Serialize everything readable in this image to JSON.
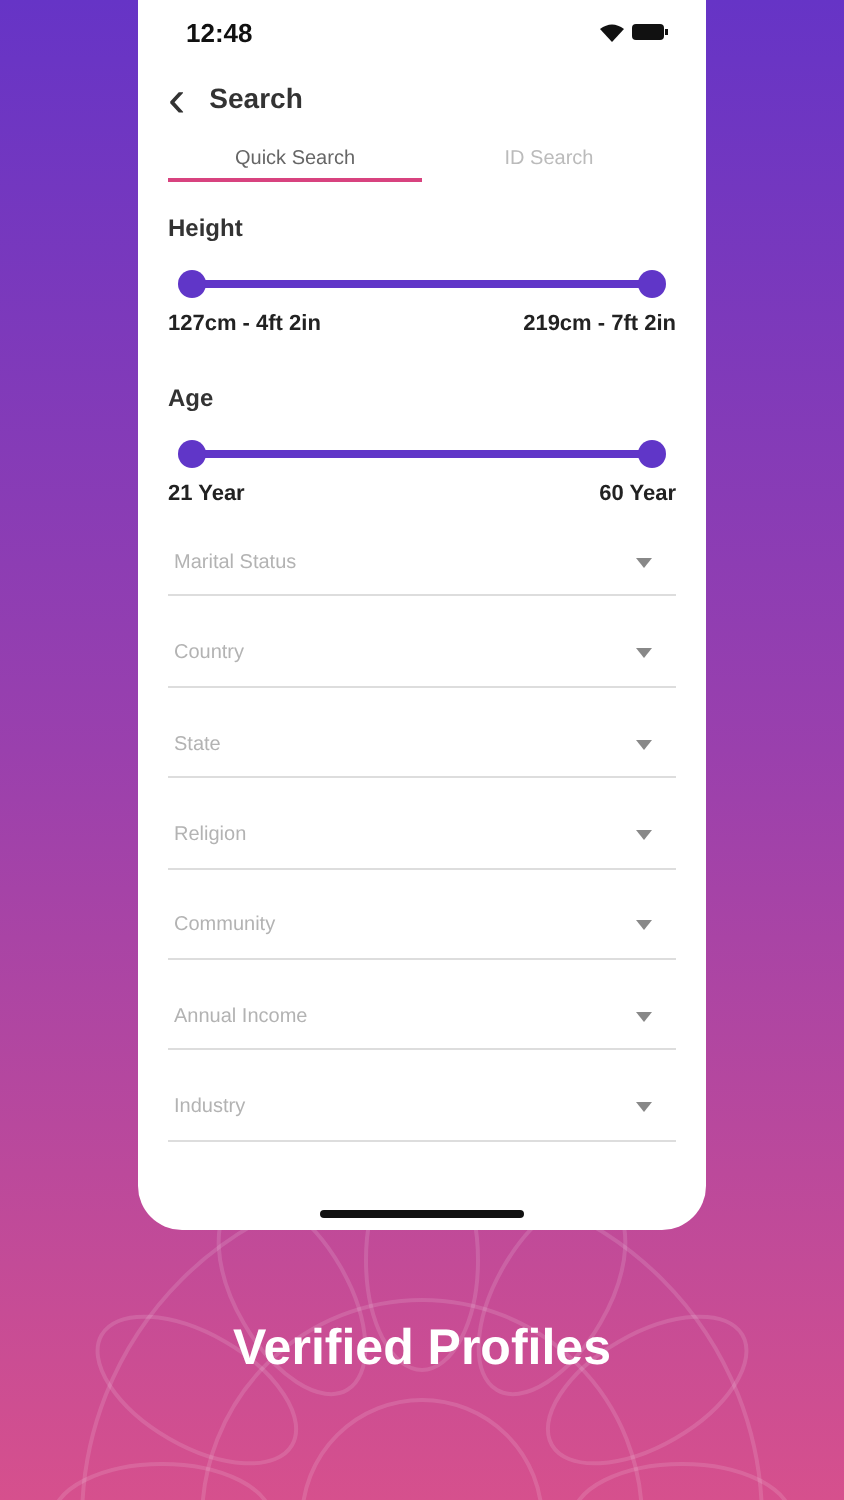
{
  "status_bar": {
    "time": "12:48"
  },
  "header": {
    "back": "‹",
    "title": "Search"
  },
  "tabs": [
    {
      "label": "Quick Search",
      "selected": true
    },
    {
      "label": "ID Search",
      "selected": false
    }
  ],
  "sliders": [
    {
      "label": "Height",
      "thumbs": [
        {
          "level": 0
        },
        {
          "level": 1
        }
      ],
      "min_text": "127cm - 4ft 2in",
      "max_text": "219cm - 7ft 2in"
    },
    {
      "label": "Age",
      "thumbs": [
        {
          "level": 0
        },
        {
          "level": 1
        }
      ],
      "min_text": "21 Year",
      "max_text": "60 Year"
    }
  ],
  "dropdowns": [
    {
      "placeholder": "Marital Status"
    },
    {
      "placeholder": "Country"
    },
    {
      "placeholder": "State"
    },
    {
      "placeholder": "Religion"
    },
    {
      "placeholder": "Community"
    },
    {
      "placeholder": "Annual Income"
    },
    {
      "placeholder": "Industry"
    }
  ],
  "caption": "Verified Profiles"
}
